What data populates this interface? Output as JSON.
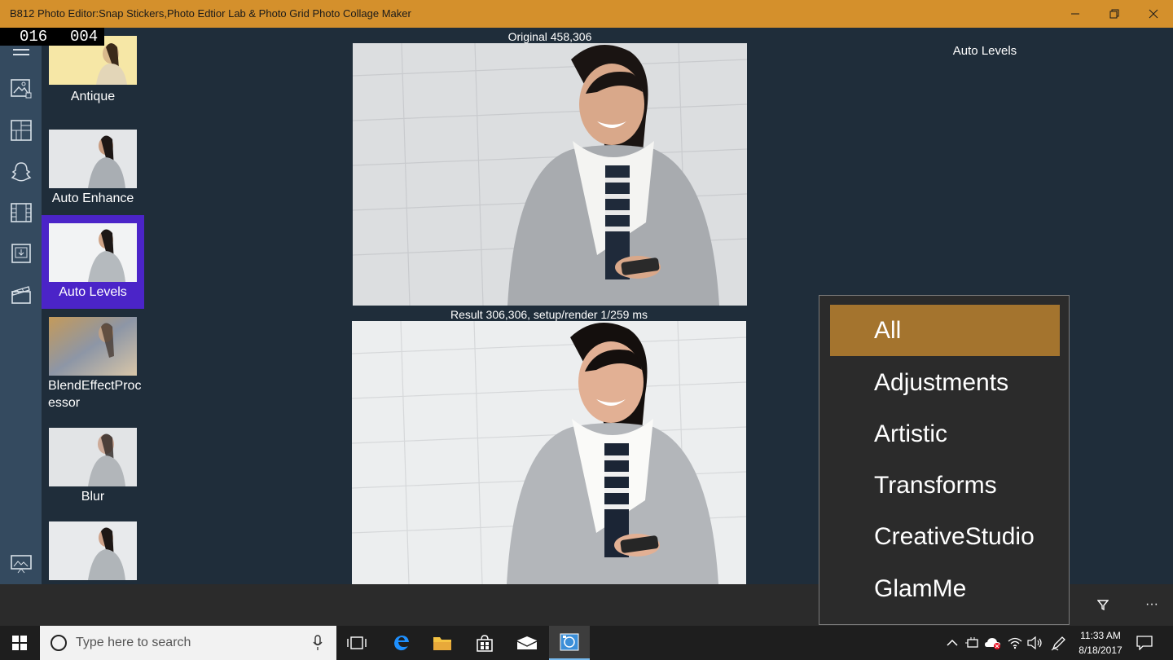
{
  "window": {
    "title": "B812 Photo Editor:Snap Stickers,Photo Edtior Lab & Photo Grid Photo Collage Maker"
  },
  "counter": {
    "left": "016",
    "right": "004"
  },
  "rail_icons": [
    "menu-icon",
    "gallery-icon",
    "grid-icon",
    "snapchat-ghost-icon",
    "film-strip-icon",
    "save-download-icon",
    "clapperboard-icon",
    "slideshow-icon"
  ],
  "effects": [
    {
      "label": "Antique",
      "selected": false
    },
    {
      "label": "Auto Enhance",
      "selected": false
    },
    {
      "label": "Auto Levels",
      "selected": true
    },
    {
      "label": "BlendEffectProc essor",
      "selected": false
    },
    {
      "label": "Blur",
      "selected": false
    },
    {
      "label": "",
      "selected": false
    }
  ],
  "main": {
    "original_caption": "Original 458,306",
    "result_caption": "Result 306,306, setup/render 1/259 ms",
    "effect_title": "Auto Levels"
  },
  "dropdown": {
    "items": [
      {
        "label": "All",
        "active": true
      },
      {
        "label": "Adjustments",
        "active": false
      },
      {
        "label": "Artistic",
        "active": false
      },
      {
        "label": "Transforms",
        "active": false
      },
      {
        "label": "CreativeStudio",
        "active": false
      },
      {
        "label": "GlamMe",
        "active": false
      }
    ]
  },
  "appbar": {
    "filter_icon": "filter-icon",
    "more_icon": "more-icon",
    "more_label": "···"
  },
  "taskbar": {
    "search_placeholder": "Type here to search",
    "time": "11:33 AM",
    "date": "8/18/2017"
  },
  "colors": {
    "title_bar": "#d4902c",
    "app_background": "#1f2d3a",
    "rail": "#344a5f",
    "selected_effect": "#4b24c8",
    "dropdown_active": "#a4742e"
  }
}
